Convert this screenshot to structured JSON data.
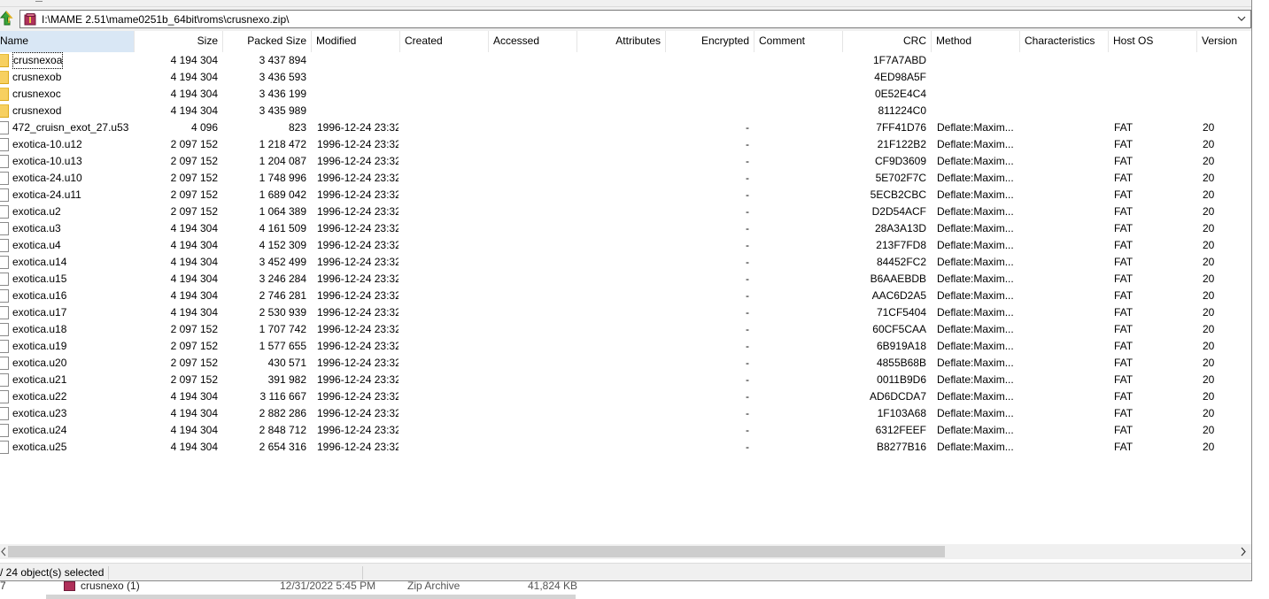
{
  "address": {
    "path": "I:\\MAME 2.51\\mame0251b_64bit\\roms\\crusnexo.zip\\"
  },
  "columns": [
    {
      "key": "name",
      "label": "Name"
    },
    {
      "key": "size",
      "label": "Size"
    },
    {
      "key": "packed",
      "label": "Packed Size"
    },
    {
      "key": "modified",
      "label": "Modified"
    },
    {
      "key": "created",
      "label": "Created"
    },
    {
      "key": "accessed",
      "label": "Accessed"
    },
    {
      "key": "attributes",
      "label": "Attributes"
    },
    {
      "key": "encrypted",
      "label": "Encrypted"
    },
    {
      "key": "comment",
      "label": "Comment"
    },
    {
      "key": "crc",
      "label": "CRC"
    },
    {
      "key": "method",
      "label": "Method"
    },
    {
      "key": "characteristics",
      "label": "Characteristics"
    },
    {
      "key": "hostos",
      "label": "Host OS"
    },
    {
      "key": "version",
      "label": "Version"
    }
  ],
  "rows": [
    {
      "type": "folder",
      "name": "crusnexoa",
      "size": "4 194 304",
      "packed": "3 437 894",
      "modified": "",
      "encrypted": "",
      "crc": "1F7A7ABD",
      "method": "",
      "hostos": "",
      "version": ""
    },
    {
      "type": "folder",
      "name": "crusnexob",
      "size": "4 194 304",
      "packed": "3 436 593",
      "modified": "",
      "encrypted": "",
      "crc": "4ED98A5F",
      "method": "",
      "hostos": "",
      "version": ""
    },
    {
      "type": "folder",
      "name": "crusnexoc",
      "size": "4 194 304",
      "packed": "3 436 199",
      "modified": "",
      "encrypted": "",
      "crc": "0E52E4C4",
      "method": "",
      "hostos": "",
      "version": ""
    },
    {
      "type": "folder",
      "name": "crusnexod",
      "size": "4 194 304",
      "packed": "3 435 989",
      "modified": "",
      "encrypted": "",
      "crc": "811224C0",
      "method": "",
      "hostos": "",
      "version": ""
    },
    {
      "type": "file",
      "name": "472_cruisn_exot_27.u53",
      "size": "4 096",
      "packed": "823",
      "modified": "1996-12-24 23:32",
      "encrypted": "-",
      "crc": "7FF41D76",
      "method": "Deflate:Maxim...",
      "hostos": "FAT",
      "version": "20"
    },
    {
      "type": "file",
      "name": "exotica-10.u12",
      "size": "2 097 152",
      "packed": "1 218 472",
      "modified": "1996-12-24 23:32",
      "encrypted": "-",
      "crc": "21F122B2",
      "method": "Deflate:Maxim...",
      "hostos": "FAT",
      "version": "20"
    },
    {
      "type": "file",
      "name": "exotica-10.u13",
      "size": "2 097 152",
      "packed": "1 204 087",
      "modified": "1996-12-24 23:32",
      "encrypted": "-",
      "crc": "CF9D3609",
      "method": "Deflate:Maxim...",
      "hostos": "FAT",
      "version": "20"
    },
    {
      "type": "file",
      "name": "exotica-24.u10",
      "size": "2 097 152",
      "packed": "1 748 996",
      "modified": "1996-12-24 23:32",
      "encrypted": "-",
      "crc": "5E702F7C",
      "method": "Deflate:Maxim...",
      "hostos": "FAT",
      "version": "20"
    },
    {
      "type": "file",
      "name": "exotica-24.u11",
      "size": "2 097 152",
      "packed": "1 689 042",
      "modified": "1996-12-24 23:32",
      "encrypted": "-",
      "crc": "5ECB2CBC",
      "method": "Deflate:Maxim...",
      "hostos": "FAT",
      "version": "20"
    },
    {
      "type": "file",
      "name": "exotica.u2",
      "size": "2 097 152",
      "packed": "1 064 389",
      "modified": "1996-12-24 23:32",
      "encrypted": "-",
      "crc": "D2D54ACF",
      "method": "Deflate:Maxim...",
      "hostos": "FAT",
      "version": "20"
    },
    {
      "type": "file",
      "name": "exotica.u3",
      "size": "4 194 304",
      "packed": "4 161 509",
      "modified": "1996-12-24 23:32",
      "encrypted": "-",
      "crc": "28A3A13D",
      "method": "Deflate:Maxim...",
      "hostos": "FAT",
      "version": "20"
    },
    {
      "type": "file",
      "name": "exotica.u4",
      "size": "4 194 304",
      "packed": "4 152 309",
      "modified": "1996-12-24 23:32",
      "encrypted": "-",
      "crc": "213F7FD8",
      "method": "Deflate:Maxim...",
      "hostos": "FAT",
      "version": "20"
    },
    {
      "type": "file",
      "name": "exotica.u14",
      "size": "4 194 304",
      "packed": "3 452 499",
      "modified": "1996-12-24 23:32",
      "encrypted": "-",
      "crc": "84452FC2",
      "method": "Deflate:Maxim...",
      "hostos": "FAT",
      "version": "20"
    },
    {
      "type": "file",
      "name": "exotica.u15",
      "size": "4 194 304",
      "packed": "3 246 284",
      "modified": "1996-12-24 23:32",
      "encrypted": "-",
      "crc": "B6AAEBDB",
      "method": "Deflate:Maxim...",
      "hostos": "FAT",
      "version": "20"
    },
    {
      "type": "file",
      "name": "exotica.u16",
      "size": "4 194 304",
      "packed": "2 746 281",
      "modified": "1996-12-24 23:32",
      "encrypted": "-",
      "crc": "AAC6D2A5",
      "method": "Deflate:Maxim...",
      "hostos": "FAT",
      "version": "20"
    },
    {
      "type": "file",
      "name": "exotica.u17",
      "size": "4 194 304",
      "packed": "2 530 939",
      "modified": "1996-12-24 23:32",
      "encrypted": "-",
      "crc": "71CF5404",
      "method": "Deflate:Maxim...",
      "hostos": "FAT",
      "version": "20"
    },
    {
      "type": "file",
      "name": "exotica.u18",
      "size": "2 097 152",
      "packed": "1 707 742",
      "modified": "1996-12-24 23:32",
      "encrypted": "-",
      "crc": "60CF5CAA",
      "method": "Deflate:Maxim...",
      "hostos": "FAT",
      "version": "20"
    },
    {
      "type": "file",
      "name": "exotica.u19",
      "size": "2 097 152",
      "packed": "1 577 655",
      "modified": "1996-12-24 23:32",
      "encrypted": "-",
      "crc": "6B919A18",
      "method": "Deflate:Maxim...",
      "hostos": "FAT",
      "version": "20"
    },
    {
      "type": "file",
      "name": "exotica.u20",
      "size": "2 097 152",
      "packed": "430 571",
      "modified": "1996-12-24 23:32",
      "encrypted": "-",
      "crc": "4855B68B",
      "method": "Deflate:Maxim...",
      "hostos": "FAT",
      "version": "20"
    },
    {
      "type": "file",
      "name": "exotica.u21",
      "size": "2 097 152",
      "packed": "391 982",
      "modified": "1996-12-24 23:32",
      "encrypted": "-",
      "crc": "0011B9D6",
      "method": "Deflate:Maxim...",
      "hostos": "FAT",
      "version": "20"
    },
    {
      "type": "file",
      "name": "exotica.u22",
      "size": "4 194 304",
      "packed": "3 116 667",
      "modified": "1996-12-24 23:32",
      "encrypted": "-",
      "crc": "AD6DCDA7",
      "method": "Deflate:Maxim...",
      "hostos": "FAT",
      "version": "20"
    },
    {
      "type": "file",
      "name": "exotica.u23",
      "size": "4 194 304",
      "packed": "2 882 286",
      "modified": "1996-12-24 23:32",
      "encrypted": "-",
      "crc": "1F103A68",
      "method": "Deflate:Maxim...",
      "hostos": "FAT",
      "version": "20"
    },
    {
      "type": "file",
      "name": "exotica.u24",
      "size": "4 194 304",
      "packed": "2 848 712",
      "modified": "1996-12-24 23:32",
      "encrypted": "-",
      "crc": "6312FEEF",
      "method": "Deflate:Maxim...",
      "hostos": "FAT",
      "version": "20"
    },
    {
      "type": "file",
      "name": "exotica.u25",
      "size": "4 194 304",
      "packed": "2 654 316",
      "modified": "1996-12-24 23:32",
      "encrypted": "-",
      "crc": "B8277B16",
      "method": "Deflate:Maxim...",
      "hostos": "FAT",
      "version": "20"
    }
  ],
  "status": {
    "selection": "/ 24 object(s) selected"
  },
  "background_window": {
    "row_marker": "7",
    "name": "crusnexo (1)",
    "date": "12/31/2022 5:45 PM",
    "type": "Zip Archive",
    "size": "41,824 KB"
  },
  "colors": {
    "sorted_header": "#d9e7f5",
    "folder_icon": "#f7d060",
    "chrome_bg": "#f0f0f0",
    "scroll_thumb": "#cdcdcd"
  },
  "icons": {
    "up": "green-up-arrow-icon",
    "archive": "zip-archive-icon",
    "folder": "folder-icon",
    "file": "file-icon"
  }
}
